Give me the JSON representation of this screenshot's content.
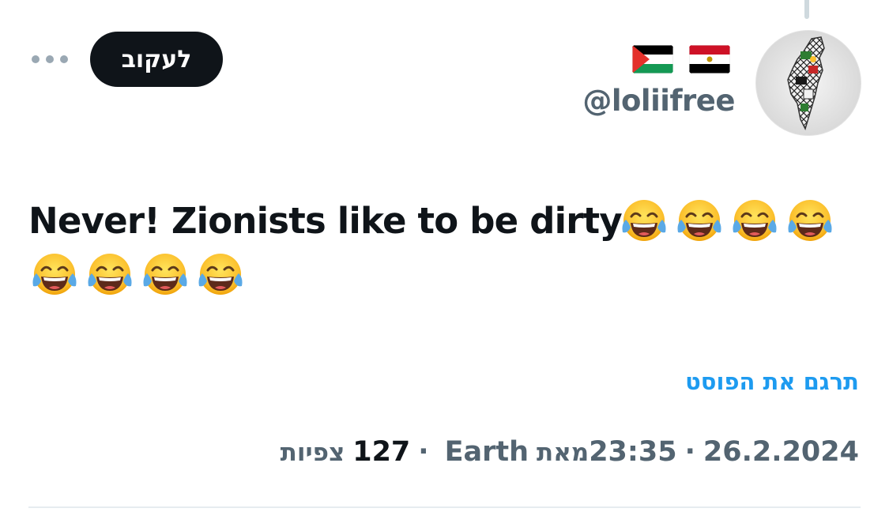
{
  "header": {
    "handle": "@loliifree",
    "flags": [
      "palestine-flag",
      "egypt-flag"
    ],
    "follow_label": "לעקוב",
    "more_icon": "more-horizontal-icon"
  },
  "tweet": {
    "text": "Never! Zionists like to be dirty",
    "emoji": "face-with-tears-of-joy",
    "emoji_count": 8
  },
  "translate_label": "תרגם את הפוסט",
  "meta": {
    "date": "26.2.2024",
    "time": "23:35",
    "from_label": "מאת",
    "location": "Earth",
    "views_count": "127",
    "views_label": "צפיות"
  },
  "colors": {
    "text": "#0f1419",
    "secondary": "#536471",
    "link": "#1d9bf0",
    "button_bg": "#0f1419"
  }
}
